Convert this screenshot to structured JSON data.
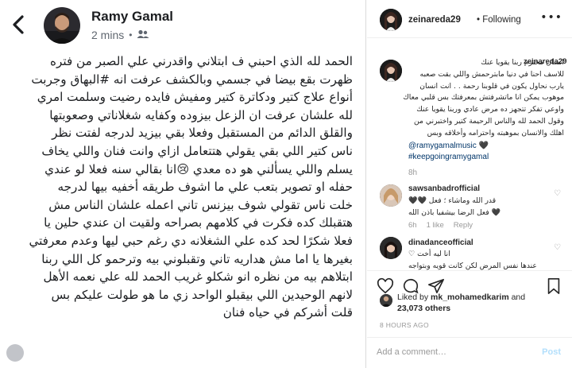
{
  "facebook": {
    "author": "Ramy Gamal",
    "time": "2 mins",
    "post_lines": [
      "الحمد لله الذي احبني ف ابتلاني واقدرني علي الصبر من فتره",
      "ظهرت بقع بيضا في جسمي وبالكشف عرفت انه #البهاق وجربت",
      "أنواع علاج كتير  ودكاترة كتير ومفيش فايده رضيت وسلمت امري",
      "لله علشان عرفت ان الزعل بيزوده وكفايه شغلاناتي وصعوبتها",
      "والقلق الدائم من المستقبل وفعلا بقي بيزيد لدرجه لفتت نظر",
      "ناس كتير اللي بقي  يقولي هتتعامل ازاي وانت فنان واللي يخاف",
      "يسلم واللي يسألني هو ده معدي 😢انا بقالي سنه فعلا لو عندي",
      "حفله او تصوير بتعب علي ما اشوف طريقه أخفيه بيها  لدرجه",
      "خلت ناس تقولي شوف بيزنس تاني اعمله علشان الناس مش",
      "هتقبلك كده فكرت في كلامهم بصراحه ولقيت ان عندي حلين يا",
      "فعلا شكرًا لحد كده علي الشغلانه دي رغم حبي ليها وعدم معرفتي",
      "بغيرها يا اما مش هداريه تاني وتقبلوني بيه  وترحمو كل اللي ربنا",
      "ابتلاهم  بيه من نظره انو شكلو غريب  الحمد لله علي  نعمه الأهل",
      "لانهم الوحيدين اللي بيقبلو الواحد زي ما هو طولت عليكم بس",
      "قلت أشركم   في حياه فنان"
    ]
  },
  "instagram": {
    "header": {
      "username": "zeinareda29",
      "follow_label": "• Following",
      "more": "•••"
    },
    "caption": {
      "username": "zeinareda29",
      "lines": [
        "انسان محترم ربنا يقويا عنك",
        "للاسف احنا في دنيا مابترحمش واللي بقت صعبه",
        "يارب نحاول يكون في قلوبنا رحمة . . انت انسان",
        "موهوب يمكن انا ماتشرفتش بمعرفتك بس قلبي معاك",
        "واوعي تفكر تتجهز ده مرض عادي وربنا يقويا عنك",
        "وقول الحمد لله والناس الرحيمة كتير واختبرني من",
        "اهلك والانسان بموهبته واحترامه وأخلاقه وبس"
      ],
      "mention": "@ramygamalmusic 🖤",
      "hashtag": "#keepgoingramygamal",
      "time": "8h"
    },
    "comments": [
      {
        "username": "sawsanbadrofficial",
        "lines": [
          "قدر الله وماشاء ؛ فعل 🖤🖤",
          "🖤 فعل الرضا بيشفيا باذن الله"
        ],
        "time": "6h",
        "likes": "1 like",
        "reply": "Reply"
      },
      {
        "username": "dinadanceofficial",
        "lines": [
          "انا ليه أخت ♡",
          "عندها نفس المرض لكن كانت قويه وبتواجه"
        ]
      }
    ],
    "liked_by": {
      "prefix": "Liked by",
      "user": "mk_mohamedkarim",
      "and": "and",
      "count": "23,073 others"
    },
    "posted": "8 HOURS AGO",
    "add_comment": {
      "placeholder": "Add a comment…",
      "post_label": "Post"
    }
  }
}
